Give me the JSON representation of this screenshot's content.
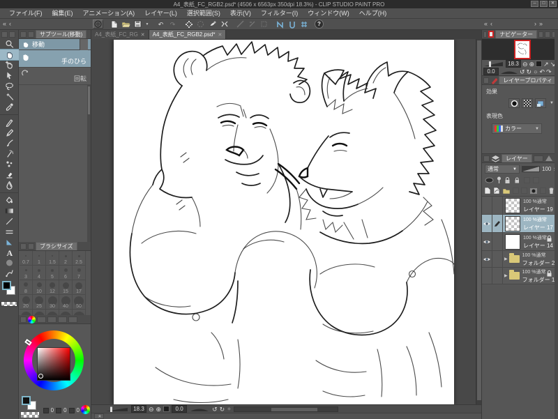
{
  "window": {
    "title": "A4_表紙_FC_RGB2.psd* (4506 x 6563px 350dpi 18.3%) - CLIP STUDIO PAINT PRO"
  },
  "menu": {
    "items": [
      "ファイル(F)",
      "編集(E)",
      "アニメーション(A)",
      "レイヤー(L)",
      "選択範囲(S)",
      "表示(V)",
      "フィルター(I)",
      "ウィンドウ(W)",
      "ヘルプ(H)"
    ]
  },
  "subtool_panel": {
    "tab": "サブツール(移動)",
    "group": "移動",
    "items": [
      {
        "label": "手のひら"
      },
      {
        "label": "回転"
      }
    ]
  },
  "brush_size_panel": {
    "tab": "ブラシサイズ",
    "sizes": [
      "0.7",
      "1",
      "1.5",
      "2",
      "2.5",
      "3",
      "4",
      "5",
      "6",
      "7",
      "8",
      "10",
      "12",
      "15",
      "17",
      "20",
      "25",
      "30",
      "40",
      "50"
    ]
  },
  "color_panel": {
    "values": [
      "0",
      "0",
      "0"
    ]
  },
  "canvas": {
    "tabs": [
      {
        "label": "A4_表紙_FC_RG"
      },
      {
        "label": "A4_表紙_FC_RGB2.psd*"
      }
    ],
    "zoom": "18.3",
    "rotation": "0.0"
  },
  "navigator": {
    "tab": "ナビゲーター",
    "zoom": "18.3",
    "rotation": "0.0"
  },
  "layer_property": {
    "tab": "レイヤープロパティ",
    "effect_label": "効果",
    "expression_label": "表現色",
    "expression_value": "カラー"
  },
  "layer_panel": {
    "tab": "レイヤー",
    "blend_mode": "通常",
    "opacity": "100",
    "layers": [
      {
        "info": "100 %通常",
        "name": "レイヤー 19"
      },
      {
        "info": "100 %通常",
        "name": "レイヤー 17"
      },
      {
        "info": "100 %通常",
        "name": "レイヤー 14"
      },
      {
        "info": "100 %通常",
        "name": "フォルダー 2"
      },
      {
        "info": "100 %通常",
        "name": "フォルダー 1"
      }
    ]
  },
  "icons": {
    "collapse_double": "«",
    "collapse_single": "‹",
    "expand_single": "›",
    "expand_double": "»",
    "minimize": "─",
    "maximize": "□",
    "close": "✕",
    "tab_close": "✕",
    "undo": "↶",
    "redo": "↷",
    "zoom_out": "⊖",
    "zoom_in": "⊕",
    "rotate_ccw": "↺",
    "rotate_cw": "↻",
    "reset": "☼",
    "dropdown": "▼",
    "expand_row": "▶",
    "spin_up": "▲",
    "spin_down": "▼",
    "arrow_ne": "↗",
    "arrow_se": "↘",
    "help": "?"
  },
  "colors": {
    "selection_accent": "#87a1af",
    "selected_layer": "#9db6c2",
    "canvas_bg": "#ffffff",
    "ui_bg": "#4e4e4e",
    "folder_icon": "#d9c878",
    "navigator_frame": "#cc2222"
  }
}
